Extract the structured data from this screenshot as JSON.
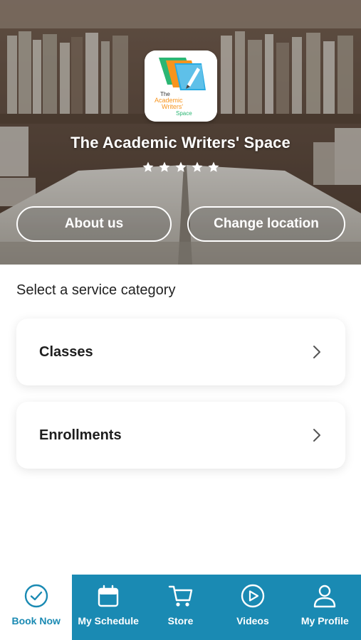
{
  "hero": {
    "business_name": "The Academic Writers' Space",
    "rating_stars": 5,
    "about_label": "About us",
    "location_label": "Change location"
  },
  "logo": {
    "line1": "The",
    "line2": "Academic",
    "line3": "Writers'",
    "line4": "Space"
  },
  "services": {
    "heading": "Select a service category",
    "items": [
      {
        "label": "Classes"
      },
      {
        "label": "Enrollments"
      }
    ]
  },
  "tabs": [
    {
      "label": "Book Now",
      "icon": "check-circle-icon",
      "active": true
    },
    {
      "label": "My Schedule",
      "icon": "calendar-icon",
      "active": false
    },
    {
      "label": "Store",
      "icon": "cart-icon",
      "active": false
    },
    {
      "label": "Videos",
      "icon": "play-circle-icon",
      "active": false
    },
    {
      "label": "My Profile",
      "icon": "user-icon",
      "active": false
    }
  ],
  "colors": {
    "accent": "#1a8ab3",
    "text_dark": "#1e1e1e"
  }
}
